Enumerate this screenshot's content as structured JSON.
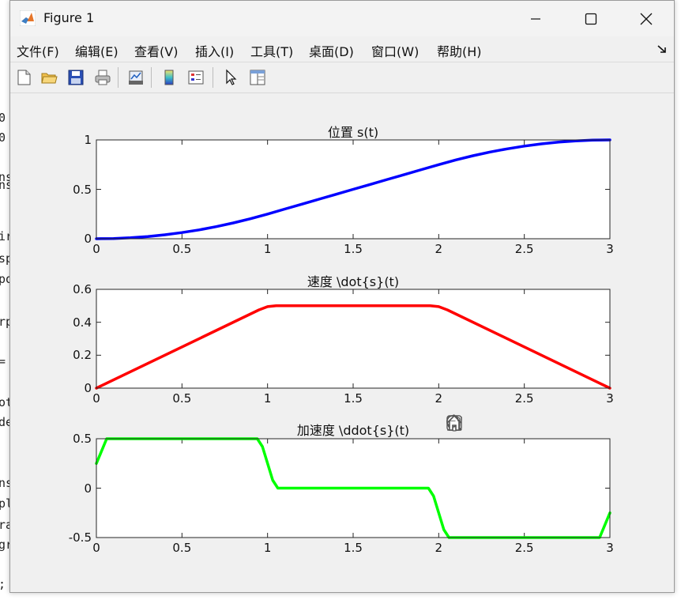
{
  "window": {
    "title": "Figure 1"
  },
  "menu": [
    "文件(F)",
    "编辑(E)",
    "查看(V)",
    "插入(I)",
    "工具(T)",
    "桌面(D)",
    "窗口(W)",
    "帮助(H)"
  ],
  "background_code": [
    "0",
    "0",
    "ns",
    "ns",
    "ir",
    "sp",
    "po",
    "rp",
    "=",
    "ot",
    "de",
    "ns",
    "pl",
    "ra",
    "gr",
    ";"
  ],
  "chart_data": [
    {
      "type": "line",
      "title": "位置 s(t)",
      "xlim": [
        0,
        3
      ],
      "ylim": [
        0,
        1
      ],
      "xticks": [
        "0",
        "0.5",
        "1",
        "1.5",
        "2",
        "2.5",
        "3"
      ],
      "yticks": [
        "0",
        "0.5",
        "1"
      ],
      "series": [
        {
          "color": "#0000ff",
          "x": [
            0,
            0.1,
            0.2,
            0.3,
            0.4,
            0.5,
            0.6,
            0.7,
            0.8,
            0.9,
            1.0,
            1.1,
            1.2,
            1.3,
            1.4,
            1.5,
            1.6,
            1.7,
            1.8,
            1.9,
            2.0,
            2.1,
            2.2,
            2.3,
            2.4,
            2.5,
            2.6,
            2.7,
            2.8,
            2.9,
            3.0
          ],
          "y": [
            0,
            0.0025,
            0.01,
            0.0225,
            0.04,
            0.0625,
            0.09,
            0.1225,
            0.16,
            0.2025,
            0.25,
            0.3,
            0.35,
            0.4,
            0.45,
            0.5,
            0.55,
            0.6,
            0.65,
            0.7,
            0.75,
            0.7975,
            0.84,
            0.8775,
            0.91,
            0.9375,
            0.96,
            0.9775,
            0.99,
            0.9975,
            1.0
          ]
        }
      ]
    },
    {
      "type": "line",
      "title": "速度 \\dot{s}(t)",
      "xlim": [
        0,
        3
      ],
      "ylim": [
        0,
        0.6
      ],
      "xticks": [
        "0",
        "0.5",
        "1",
        "1.5",
        "2",
        "2.5",
        "3"
      ],
      "yticks": [
        "0",
        "0.2",
        "0.4",
        "0.6"
      ],
      "series": [
        {
          "color": "#ff0000",
          "x": [
            0,
            0.95,
            1.0,
            1.05,
            1.95,
            2.0,
            2.05,
            3.0
          ],
          "y": [
            0,
            0.475,
            0.495,
            0.5,
            0.5,
            0.495,
            0.475,
            0
          ]
        }
      ]
    },
    {
      "type": "line",
      "title": "加速度 \\ddot{s}(t)",
      "xlim": [
        0,
        3
      ],
      "ylim": [
        -0.5,
        0.5
      ],
      "xticks": [
        "0",
        "0.5",
        "1",
        "1.5",
        "2",
        "2.5",
        "3"
      ],
      "yticks": [
        "-0.5",
        "0",
        "0.5"
      ],
      "series": [
        {
          "color": "#00ff00",
          "x": [
            0,
            0.06,
            0.94,
            0.97,
            1.0,
            1.03,
            1.06,
            1.94,
            1.97,
            2.0,
            2.03,
            2.06,
            2.94,
            3.0
          ],
          "y": [
            0.25,
            0.5,
            0.5,
            0.42,
            0.25,
            0.08,
            0,
            0,
            -0.08,
            -0.25,
            -0.42,
            -0.5,
            -0.5,
            -0.25
          ]
        }
      ]
    }
  ]
}
